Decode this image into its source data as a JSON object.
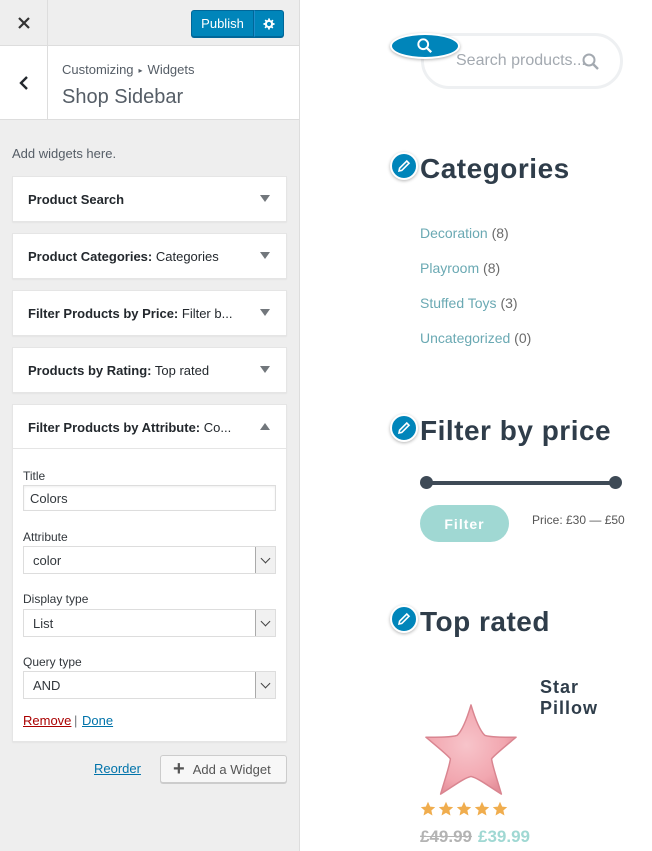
{
  "topbar": {
    "publish_label": "Publish"
  },
  "header": {
    "breadcrumb_root": "Customizing",
    "breadcrumb_sep": "▸",
    "breadcrumb_parent": "Widgets",
    "section_title": "Shop Sidebar"
  },
  "panel": {
    "description": "Add widgets here."
  },
  "widgets": [
    {
      "name": "Product Search",
      "instance": ""
    },
    {
      "name": "Product Categories:",
      "instance": " Categories"
    },
    {
      "name": "Filter Products by Price:",
      "instance": " Filter b..."
    },
    {
      "name": "Products by Rating:",
      "instance": " Top rated"
    },
    {
      "name": "Filter Products by Attribute:",
      "instance": " Co..."
    }
  ],
  "attribute_form": {
    "title_label": "Title",
    "title_value": "Colors",
    "attribute_label": "Attribute",
    "attribute_value": "color",
    "display_type_label": "Display type",
    "display_type_value": "List",
    "query_type_label": "Query type",
    "query_type_value": "AND",
    "remove_label": "Remove",
    "separator": "|",
    "done_label": "Done"
  },
  "footer": {
    "reorder_label": "Reorder",
    "add_widget_label": "Add a Widget"
  },
  "preview": {
    "search_placeholder": "Search products...",
    "categories_title": "Categories",
    "categories": [
      {
        "name": "Decoration",
        "count": "(8)"
      },
      {
        "name": "Playroom",
        "count": "(8)"
      },
      {
        "name": "Stuffed Toys",
        "count": "(3)"
      },
      {
        "name": "Uncategorized",
        "count": "(0)"
      }
    ],
    "price_title": "Filter by price",
    "filter_button": "Filter",
    "price_range": "Price: £30 — £50",
    "price_slider": {
      "min": 30,
      "max": 50
    },
    "top_rated_title": "Top rated",
    "product": {
      "name": "Star Pillow",
      "rating": 5,
      "old_price": "£49.99",
      "new_price": "£39.99"
    }
  },
  "colors": {
    "wp_blue": "#0085ba",
    "link_blue": "#0073aa",
    "remove_red": "#aa0000",
    "accent_teal": "#a0d8d3",
    "category_link": "#6aa9b3",
    "heading_dark": "#2f3d4a",
    "star_orange": "#f0ad4e",
    "pillow_pink": "#f2a7b0"
  },
  "icons": {
    "close": "close-icon",
    "settings": "gear-icon",
    "back": "chevron-left-icon",
    "toggle_down": "triangle-down-icon",
    "toggle_up": "triangle-up-icon",
    "plus": "plus-icon",
    "search": "search-icon",
    "edit": "pencil-icon",
    "star": "star-icon"
  }
}
